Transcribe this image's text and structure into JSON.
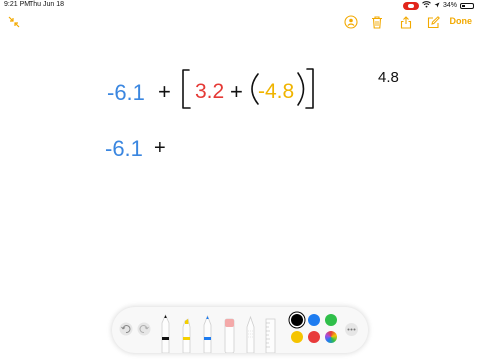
{
  "status": {
    "time": "9:21 PM",
    "date": "Thu Jun 18",
    "battery": "34%",
    "battery_level": 0.34
  },
  "toolbar": {
    "done_label": "Done",
    "accent": "#f2a900"
  },
  "canvas": {
    "line1": {
      "term1": "-6.1",
      "plus1": "+",
      "open_bracket": "[",
      "term2": "3.2",
      "plus2": "+",
      "open_paren": "(",
      "term3": "-4.8",
      "close_paren": ")",
      "close_bracket": "]"
    },
    "side_note": "4.8",
    "line2": {
      "term1": "-6.1",
      "plus": "+"
    },
    "colors": {
      "blue": "#3a86e0",
      "red": "#e53935",
      "yellow": "#f0b400",
      "black": "#111111"
    }
  },
  "palette": {
    "tools": [
      "undo-icon",
      "redo-icon",
      "pen-tool",
      "marker-tool",
      "pencil-tool",
      "eraser-tool",
      "lasso-tool",
      "ruler-tool"
    ],
    "colors": [
      "#000000",
      "#1e7cf0",
      "#2fbf4a",
      "#f5c400",
      "#e83b3b"
    ],
    "selected_color": "#000000"
  }
}
